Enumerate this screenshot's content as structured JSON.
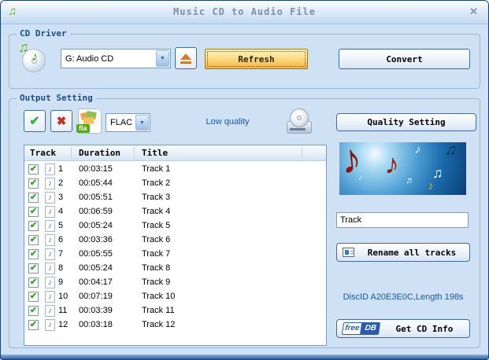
{
  "window": {
    "title": "Music CD to Audio File",
    "close_glyph": "✕"
  },
  "cd_driver": {
    "group_label": "CD Driver",
    "drive_select_value": "G: Audio CD",
    "refresh_label": "Refresh",
    "convert_label": "Convert"
  },
  "output_setting": {
    "group_label": "Output Setting",
    "format_select_value": "FLAC",
    "format_badge": "fla",
    "quality_text": "Low quality",
    "quality_button_label": "Quality Setting"
  },
  "track_list": {
    "headers": {
      "track": "Track",
      "duration": "Duration",
      "title": "Title"
    },
    "rows": [
      {
        "num": "1",
        "duration": "00:03:15",
        "title": "Track 1",
        "checked": true
      },
      {
        "num": "2",
        "duration": "00:05:44",
        "title": "Track 2",
        "checked": true
      },
      {
        "num": "3",
        "duration": "00:05:51",
        "title": "Track 3",
        "checked": true
      },
      {
        "num": "4",
        "duration": "00:06:59",
        "title": "Track 4",
        "checked": true
      },
      {
        "num": "5",
        "duration": "00:05:24",
        "title": "Track 5",
        "checked": true
      },
      {
        "num": "6",
        "duration": "00:03:36",
        "title": "Track 6",
        "checked": true
      },
      {
        "num": "7",
        "duration": "00:05:55",
        "title": "Track 7",
        "checked": true
      },
      {
        "num": "8",
        "duration": "00:05:24",
        "title": "Track 8",
        "checked": true
      },
      {
        "num": "9",
        "duration": "00:04:17",
        "title": "Track 9",
        "checked": true
      },
      {
        "num": "10",
        "duration": "00:07:19",
        "title": "Track 10",
        "checked": true
      },
      {
        "num": "11",
        "duration": "00:03:39",
        "title": "Track 11",
        "checked": true
      },
      {
        "num": "12",
        "duration": "00:03:18",
        "title": "Track 12",
        "checked": true
      }
    ]
  },
  "right_panel": {
    "track_name_value": "Track",
    "rename_button_label": "Rename all tracks",
    "disc_info": "DiscID A20E3E0C,Length 198s",
    "freedb_free": "free",
    "freedb_db": "DB",
    "get_cd_info_label": "Get CD Info"
  },
  "icons": {
    "app_note": "♫",
    "note": "♪",
    "beamed_note": "♫",
    "sixteenth_notes": "♬",
    "check": "✔",
    "cross": "✖",
    "dropdown_arrow": "▼"
  },
  "colors": {
    "accent_blue": "#1d55a8",
    "navy_label": "#1c4c84",
    "refresh_gold": "#f4b23e",
    "check_green": "#3db13d",
    "cross_red": "#c03028",
    "freedb_blue": "#2b5cab",
    "window_bg": "#cfe2f5"
  }
}
